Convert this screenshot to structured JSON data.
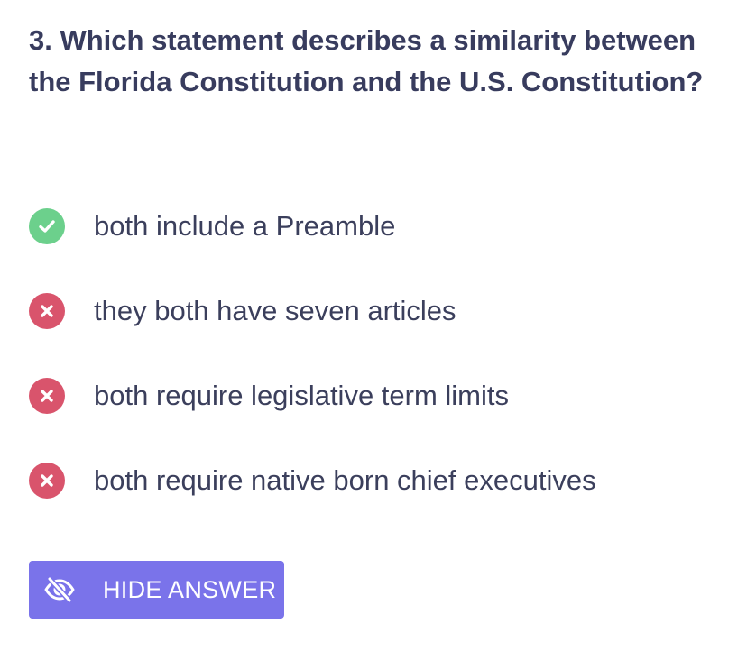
{
  "question": {
    "text": "3. Which statement describes a similarity between the Florida Constitution and the U.S. Constitution?"
  },
  "options": [
    {
      "label": "both include a Preamble",
      "status": "correct",
      "icon": "check-icon"
    },
    {
      "label": "they both have seven articles",
      "status": "incorrect",
      "icon": "x-icon"
    },
    {
      "label": "both require legislative term limits",
      "status": "incorrect",
      "icon": "x-icon"
    },
    {
      "label": "both require native born chief executives",
      "status": "incorrect",
      "icon": "x-icon"
    }
  ],
  "hide_button": {
    "label": "HIDE ANSWER",
    "icon": "eye-slash-icon"
  },
  "colors": {
    "correct": "#6cd08c",
    "incorrect": "#d9546c",
    "button": "#7a73ea",
    "text": "#383c5e"
  }
}
